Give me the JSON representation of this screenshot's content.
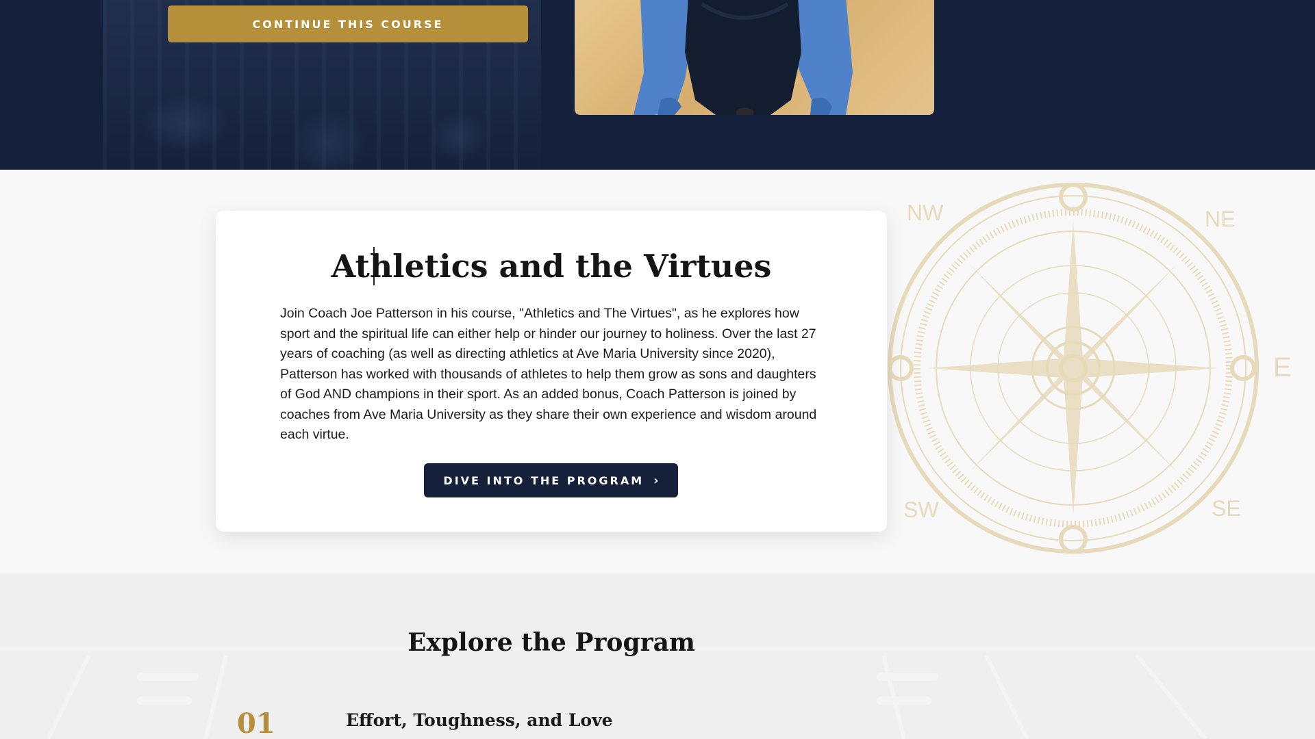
{
  "hero": {
    "continue_label": "CONTINUE THIS COURSE"
  },
  "about": {
    "title": "Athletics and the Virtues",
    "description": "Join Coach Joe Patterson in his course, \"Athletics and The Virtues\", as he explores how sport and the spiritual life can either help or hinder our journey to holiness. Over the last 27 years of coaching (as well as directing athletics at Ave Maria University since 2020), Patterson has worked with thousands of athletes to help them grow as sons and daughters of God AND champions in their sport. As an added bonus, Coach Patterson is joined by coaches from Ave Maria University as they share their own experience and wisdom around each virtue.",
    "dive_label": "DIVE INTO THE PROGRAM",
    "dive_chevron": "›",
    "compass_labels": {
      "nw": "NW",
      "ne": "NE",
      "sw": "SW",
      "se": "SE",
      "e": "E"
    }
  },
  "explore": {
    "title": "Explore the Program",
    "modules": [
      {
        "number": "01",
        "title": "Effort, Toughness, and Love"
      }
    ]
  },
  "colors": {
    "navy": "#15203a",
    "gold": "#b58f3a",
    "compass": "#d9c28a"
  }
}
